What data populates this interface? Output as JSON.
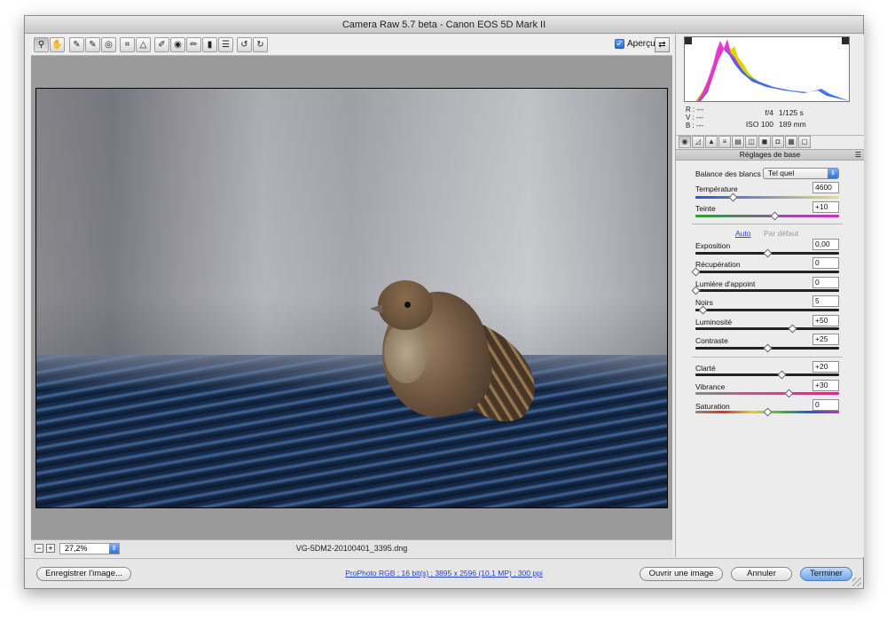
{
  "window": {
    "title": "Camera Raw 5.7 beta  -  Canon EOS 5D Mark II"
  },
  "toolbar": {
    "tools": [
      {
        "name": "zoom-tool",
        "icon": "🔍"
      },
      {
        "name": "hand-tool",
        "icon": "✋"
      },
      {
        "name": "white-balance-tool",
        "icon": "✎"
      },
      {
        "name": "color-sampler-tool",
        "icon": "✎"
      },
      {
        "name": "targeted-adjustment-tool",
        "icon": "◎"
      },
      {
        "name": "crop-tool",
        "icon": "⌗"
      },
      {
        "name": "straighten-tool",
        "icon": "△"
      },
      {
        "name": "spot-removal-tool",
        "icon": "✐"
      },
      {
        "name": "red-eye-tool",
        "icon": "◉"
      },
      {
        "name": "adjustment-brush-tool",
        "icon": "✏"
      },
      {
        "name": "graduated-filter-tool",
        "icon": "▮"
      },
      {
        "name": "preferences-tool",
        "icon": "☰"
      },
      {
        "name": "rotate-left-tool",
        "icon": "↺"
      },
      {
        "name": "rotate-right-tool",
        "icon": "↻"
      }
    ],
    "preview_label": "Aperçu"
  },
  "status": {
    "zoom": "27,2%",
    "filename": "VG-5DM2-20100401_3395.dng"
  },
  "readout": {
    "r": "R :  ---",
    "v": "V :  ---",
    "b": "B :  ---",
    "aperture": "f/4",
    "shutter": "1/125 s",
    "iso": "ISO 100",
    "focal": "189 mm"
  },
  "panel": {
    "section_title": "Réglages de base",
    "white_balance_label": "Balance des blancs :",
    "white_balance_value": "Tel quel",
    "auto_label": "Auto",
    "default_label": "Par défaut",
    "sliders": {
      "temperature": {
        "label": "Température",
        "value": "4600",
        "level": 0.26
      },
      "tint": {
        "label": "Teinte",
        "value": "+10",
        "level": 0.55
      },
      "exposure": {
        "label": "Exposition",
        "value": "0,00",
        "level": 0.5
      },
      "recovery": {
        "label": "Récupération",
        "value": "0",
        "level": 0.0
      },
      "fill_light": {
        "label": "Lumière d'appoint",
        "value": "0",
        "level": 0.0
      },
      "blacks": {
        "label": "Noirs",
        "value": "5",
        "level": 0.05
      },
      "brightness": {
        "label": "Luminosité",
        "value": "+50",
        "level": 0.67
      },
      "contrast": {
        "label": "Contraste",
        "value": "+25",
        "level": 0.5
      },
      "clarity": {
        "label": "Clarté",
        "value": "+20",
        "level": 0.6
      },
      "vibrance": {
        "label": "Vibrance",
        "value": "+30",
        "level": 0.65
      },
      "saturation": {
        "label": "Saturation",
        "value": "0",
        "level": 0.5
      }
    }
  },
  "bottom": {
    "save_label": "Enregistrer l'image...",
    "workflow_label": "ProPhoto RGB ; 16 bit(s) ; 3895 x 2596 (10,1 MP) ; 300 ppi",
    "open_label": "Ouvrir une image",
    "cancel_label": "Annuler",
    "done_label": "Terminer"
  }
}
